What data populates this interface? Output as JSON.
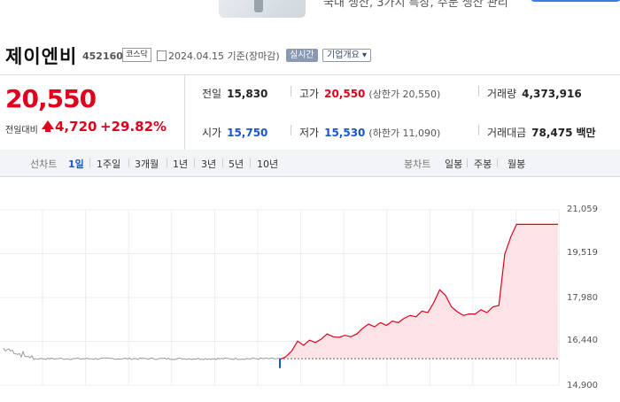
{
  "banner": {
    "text": "국내 생산, 3가지 특장, 주문 생산 관리"
  },
  "header": {
    "name": "제이엔비",
    "code": "452160",
    "market": "코스닥",
    "date": "2024.04.15 기준(장마감)",
    "realtime": "실시간",
    "company_info": "기업개요",
    "company_info_arrow": "▾"
  },
  "summary": {
    "price": "20,550",
    "change_label": "전일대비",
    "change_value": "4,720",
    "change_rate": "+29.82%",
    "prev_close": {
      "label": "전일",
      "value": "15,830"
    },
    "open": {
      "label": "시가",
      "value": "15,750"
    },
    "high": {
      "label": "고가",
      "value": "20,550",
      "sub": "(상한가 20,550)"
    },
    "low": {
      "label": "저가",
      "value": "15,530",
      "sub": "(하한가 11,090)"
    },
    "volume": {
      "label": "거래량",
      "value": "4,373,916"
    },
    "amount": {
      "label": "거래대금",
      "value": "78,475",
      "unit": "백만"
    }
  },
  "tabs": {
    "line_chart": "선차트",
    "periods": [
      "1일",
      "1주일",
      "3개월",
      "1년",
      "3년",
      "5년",
      "10년"
    ],
    "selected_period": "1일",
    "candle_chart": "봉차트",
    "candles": [
      "일봉",
      "주봉",
      "월봉"
    ]
  },
  "colors": {
    "up": "#e0001b",
    "down": "#1a55c9",
    "prev_line": "#999999",
    "fill": "#fde3e5"
  },
  "chart_data": {
    "type": "line",
    "y_ticks": [
      "21,059",
      "19,519",
      "17,980",
      "16,440",
      "14,900"
    ],
    "ylim": [
      14900,
      21059
    ],
    "reference_price": 15830,
    "grid": true,
    "series": [
      {
        "values": [
          15800,
          15900,
          16100,
          16450,
          16300,
          16480,
          16400,
          16520,
          16700,
          16600,
          16580,
          16650,
          16600,
          16700,
          16900,
          17050,
          16950,
          17100,
          17000,
          17150,
          17100,
          17250,
          17350,
          17300,
          17500,
          17450,
          17800,
          18250,
          18050,
          17650,
          17480,
          17350,
          17400,
          17400,
          17550,
          17450,
          17650,
          17700,
          19500,
          20100,
          20550,
          20550,
          20550,
          20550,
          20550,
          20550,
          20550,
          20550
        ]
      }
    ]
  }
}
